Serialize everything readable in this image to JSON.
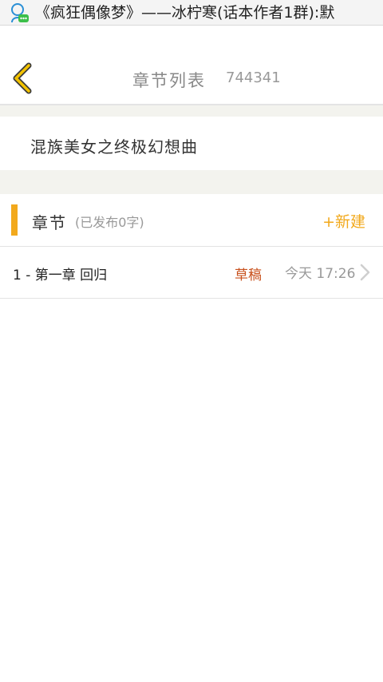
{
  "status_bar": {
    "notification_icon": "chat-bubble-person-icon",
    "text": "《疯狂偶像梦》——冰柠寒(话本作者1群):默"
  },
  "header": {
    "back_icon": "chevron-left-icon",
    "title": "章节列表",
    "id": "744341"
  },
  "novel": {
    "title": "混族美女之终极幻想曲"
  },
  "chapters_section": {
    "title": "章节",
    "subtitle": "(已发布0字)",
    "new_button": "+新建"
  },
  "chapters": [
    {
      "title": "1 - 第一章 回归",
      "status": "草稿",
      "time": "今天 17:26"
    }
  ],
  "colors": {
    "accent": "#f2a91c",
    "draft": "#c8501c",
    "background_gap": "#f3f3ee"
  }
}
